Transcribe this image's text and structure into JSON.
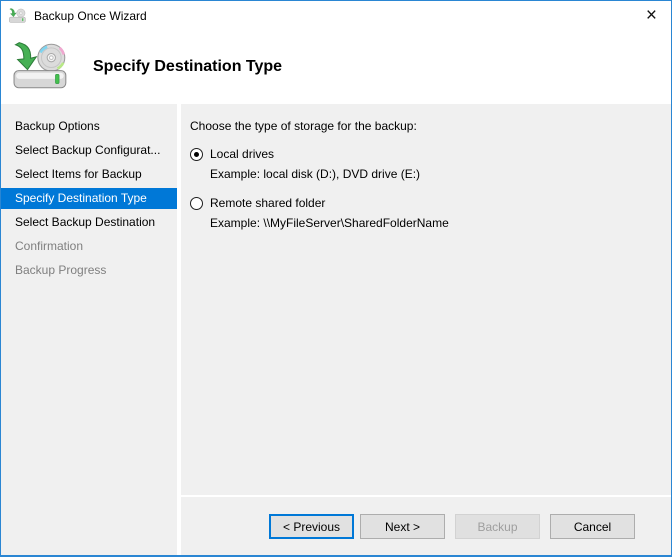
{
  "window": {
    "title": "Backup Once Wizard",
    "close_glyph": "×"
  },
  "header": {
    "title": "Specify Destination Type"
  },
  "sidebar": {
    "items": [
      {
        "label": "Backup Options",
        "state": "enabled"
      },
      {
        "label": "Select Backup Configurat...",
        "state": "enabled"
      },
      {
        "label": "Select Items for Backup",
        "state": "enabled"
      },
      {
        "label": "Specify Destination Type",
        "state": "active"
      },
      {
        "label": "Select Backup Destination",
        "state": "enabled"
      },
      {
        "label": "Confirmation",
        "state": "disabled"
      },
      {
        "label": "Backup Progress",
        "state": "disabled"
      }
    ]
  },
  "content": {
    "heading": "Choose the type of storage for the backup:",
    "options": [
      {
        "label": "Local drives",
        "example": "Example: local disk (D:), DVD drive (E:)",
        "selected": true
      },
      {
        "label": "Remote shared folder",
        "example": "Example: \\\\MyFileServer\\SharedFolderName",
        "selected": false
      }
    ]
  },
  "footer": {
    "buttons": [
      {
        "label": "< Previous",
        "state": "focused"
      },
      {
        "label": "Next >",
        "state": "enabled"
      },
      {
        "label": "Backup",
        "state": "disabled"
      },
      {
        "label": "Cancel",
        "state": "enabled"
      }
    ]
  },
  "colors": {
    "accent": "#0078d7",
    "window_border": "#2a86d3",
    "body_bg": "#f0f0f0",
    "chrome_bg": "#ffffff",
    "disabled_text": "#7f7f7f"
  }
}
